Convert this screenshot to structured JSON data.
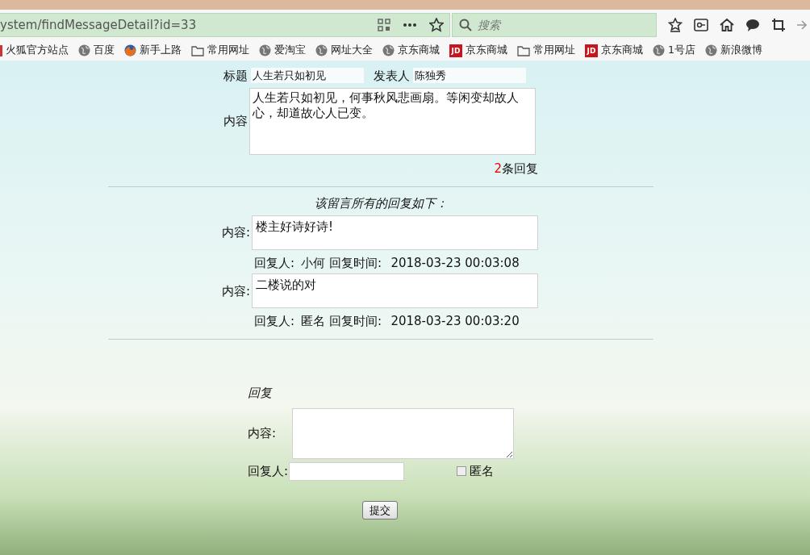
{
  "browser": {
    "url": "ystem/findMessageDetail?id=33",
    "search_placeholder": "搜索",
    "bookmarks": [
      {
        "label": "火狐官方站点",
        "kind": "cut"
      },
      {
        "label": "百度",
        "kind": "globe"
      },
      {
        "label": "新手上路",
        "kind": "firefox"
      },
      {
        "label": "常用网址",
        "kind": "folder"
      },
      {
        "label": "爱淘宝",
        "kind": "globe"
      },
      {
        "label": "网址大全",
        "kind": "globe"
      },
      {
        "label": "京东商城",
        "kind": "globe"
      },
      {
        "label": "京东商城",
        "kind": "jd",
        "icon_text": "JD"
      },
      {
        "label": "常用网址",
        "kind": "folder"
      },
      {
        "label": "京东商城",
        "kind": "jd",
        "icon_text": "JD"
      },
      {
        "label": "1号店",
        "kind": "globe"
      },
      {
        "label": "新浪微博",
        "kind": "globe"
      }
    ]
  },
  "message": {
    "title_label": "标题",
    "title": "人生若只如初见",
    "author_label": "发表人",
    "author": "陈独秀",
    "content_label": "内容",
    "content": "人生若只如初见，何事秋风悲画扇。等闲变却故人心，却道故心人已变。",
    "reply_count": "2",
    "reply_count_suffix": "条回复"
  },
  "replies_heading": "该留言所有的回复如下：",
  "replies": [
    {
      "content_label": "内容:",
      "content": "楼主好诗好诗!",
      "replier_label": "回复人:",
      "replier": "小何",
      "time_label": "回复时间:",
      "time": "2018-03-23 00:03:08"
    },
    {
      "content_label": "内容:",
      "content": "二楼说的对",
      "replier_label": "回复人:",
      "replier": "匿名",
      "time_label": "回复时间:",
      "time": "2018-03-23 00:03:20"
    }
  ],
  "reply_form": {
    "heading": "回复",
    "content_label": "内容:",
    "replier_label": "回复人:",
    "anonymous_label": "匿名",
    "anonymous_checked": false,
    "submit": "提交"
  }
}
